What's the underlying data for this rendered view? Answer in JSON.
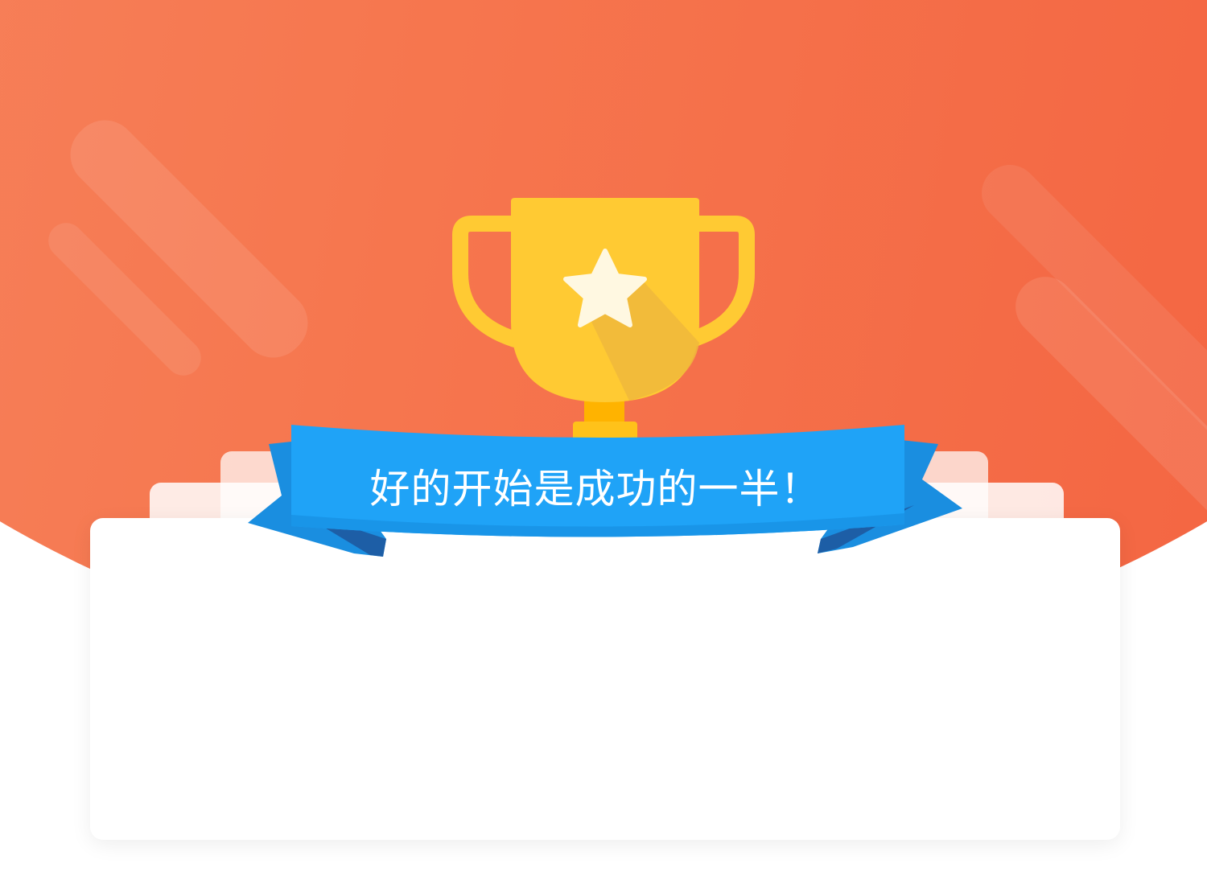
{
  "banner": {
    "text": "好的开始是成功的一半！"
  },
  "icons": {
    "trophy": "trophy-icon",
    "star": "star-icon"
  },
  "colors": {
    "background_start": "#f88c68",
    "background_end": "#f25c3b",
    "trophy_gold": "#ffca33",
    "ribbon_blue": "#1fa3f7",
    "ribbon_dark": "#1d67b8",
    "card": "#ffffff"
  }
}
